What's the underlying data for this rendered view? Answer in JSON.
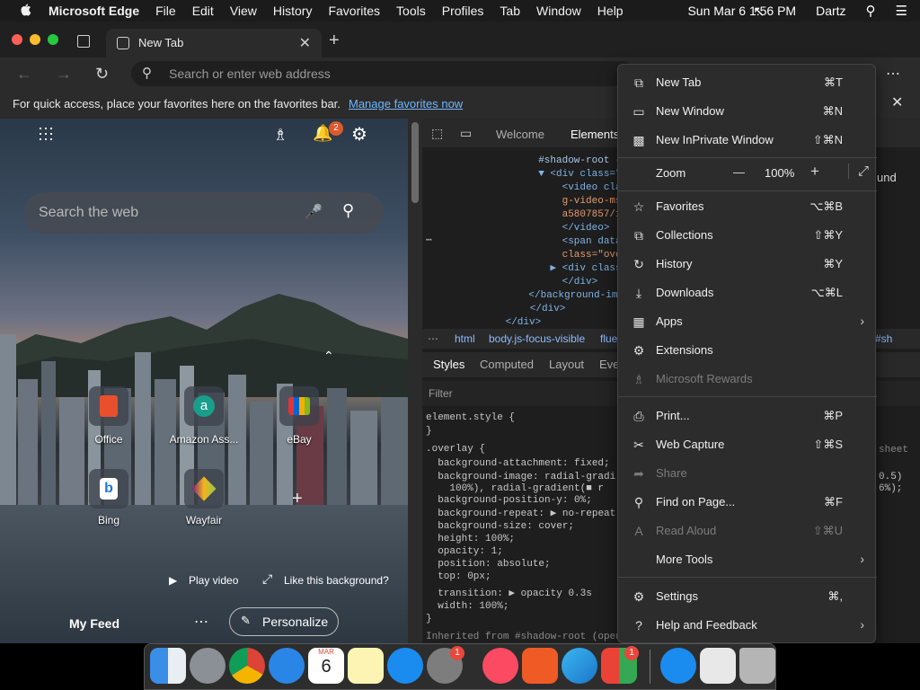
{
  "menubar": {
    "app_name": "Microsoft Edge",
    "items": [
      "File",
      "Edit",
      "View",
      "History",
      "Favorites",
      "Tools",
      "Profiles",
      "Tab",
      "Window",
      "Help"
    ],
    "clock": "Sun Mar 6  1:56 PM",
    "user": "Dartz"
  },
  "tab": {
    "title": "New Tab"
  },
  "address": {
    "placeholder": "Search or enter web address"
  },
  "favbar": {
    "message": "For quick access, place your favorites here on the favorites bar.",
    "link": "Manage favorites now"
  },
  "newtab_page": {
    "search_placeholder": "Search the web",
    "notification_count": "2",
    "tiles": [
      {
        "label": "Office"
      },
      {
        "label": "Amazon Ass..."
      },
      {
        "label": "eBay"
      },
      {
        "label": "Bing"
      },
      {
        "label": "Wayfair"
      }
    ],
    "play_video": "Play video",
    "like_background": "Like this background?",
    "my_feed": "My Feed",
    "personalize": "Personalize"
  },
  "devtools": {
    "tabs": [
      "Welcome",
      "Elements"
    ],
    "dom_lines": [
      "  #shadow-root (",
      "  ▼ <div class=\"",
      "      <video cla",
      "      g-video-ms",
      "      a5807857/1",
      "      </video>",
      "      <span data",
      "      class=\"ove",
      "    ▶ <div class",
      "      </div>",
      "    </background-ima",
      "   </div>",
      " </div>"
    ],
    "breadcrumbs": [
      "html",
      "body.js-focus-visible",
      "flue",
      "#sh"
    ],
    "styles_tabs": [
      "Styles",
      "Computed",
      "Layout",
      "Eve"
    ],
    "filter_placeholder": "Filter",
    "css_lines": [
      "element.style {",
      "}",
      ".overlay {",
      "  background-attachment: fixed;",
      "  background-image: radial-gradi",
      "    100%), radial-gradient(■ r",
      "  background-position-y: 0%;",
      "  background-repeat: ▶ no-repeat",
      "  background-size: cover;",
      "  height: 100%;",
      "  opacity: 1;",
      "  position: absolute;",
      "  top: 0px;",
      "",
      "  transition: ▶ opacity 0.3s",
      "  width: 100%;",
      "}",
      "Inherited from #shadow-root (open)"
    ],
    "right_fragments": [
      "und",
      "sheet",
      "0.5)",
      "6%);"
    ]
  },
  "menu": {
    "items": [
      {
        "icon": "new-tab-icon",
        "label": "New Tab",
        "shortcut": "⌘T"
      },
      {
        "icon": "new-window-icon",
        "label": "New Window",
        "shortcut": "⌘N"
      },
      {
        "icon": "inprivate-icon",
        "label": "New InPrivate Window",
        "shortcut": "⇧⌘N"
      },
      {
        "icon": "favorites-icon",
        "label": "Favorites",
        "shortcut": "⌥⌘B"
      },
      {
        "icon": "collections-icon",
        "label": "Collections",
        "shortcut": "⇧⌘Y"
      },
      {
        "icon": "history-icon",
        "label": "History",
        "shortcut": "⌘Y"
      },
      {
        "icon": "downloads-icon",
        "label": "Downloads",
        "shortcut": "⌥⌘L"
      },
      {
        "icon": "apps-icon",
        "label": "Apps",
        "shortcut": ""
      },
      {
        "icon": "extensions-icon",
        "label": "Extensions",
        "shortcut": ""
      },
      {
        "icon": "rewards-icon",
        "label": "Microsoft Rewards",
        "shortcut": ""
      },
      {
        "icon": "print-icon",
        "label": "Print...",
        "shortcut": "⌘P"
      },
      {
        "icon": "web-capture-icon",
        "label": "Web Capture",
        "shortcut": "⇧⌘S"
      },
      {
        "icon": "share-icon",
        "label": "Share",
        "shortcut": ""
      },
      {
        "icon": "find-icon",
        "label": "Find on Page...",
        "shortcut": "⌘F"
      },
      {
        "icon": "read-aloud-icon",
        "label": "Read Aloud",
        "shortcut": "⇧⌘U"
      },
      {
        "icon": "more-tools-icon",
        "label": "More Tools",
        "shortcut": ""
      },
      {
        "icon": "settings-icon",
        "label": "Settings",
        "shortcut": "⌘,"
      },
      {
        "icon": "help-icon",
        "label": "Help and Feedback",
        "shortcut": ""
      }
    ],
    "zoom": {
      "label": "Zoom",
      "value": "100%",
      "minus": "—",
      "plus": "+"
    }
  },
  "dock": {
    "calendar_month": "MAR",
    "calendar_day": "6",
    "settings_badge": "1",
    "store_badge": "1"
  }
}
